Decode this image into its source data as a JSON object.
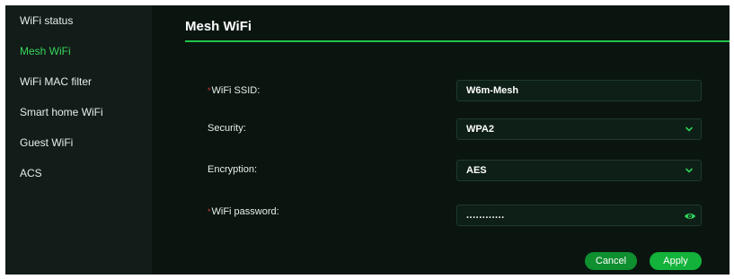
{
  "colors": {
    "accent": "#1fc44a",
    "sidebar_bg": "#121c18",
    "main_bg": "#0a1510",
    "required_mark": "#d9383b"
  },
  "sidebar": {
    "items": [
      {
        "label": "WiFi status",
        "active": false
      },
      {
        "label": "Mesh WiFi",
        "active": true
      },
      {
        "label": "WiFi MAC filter",
        "active": false
      },
      {
        "label": "Smart home WiFi",
        "active": false
      },
      {
        "label": "Guest WiFi",
        "active": false
      },
      {
        "label": "ACS",
        "active": false
      }
    ]
  },
  "page": {
    "title": "Mesh WiFi"
  },
  "form": {
    "ssid": {
      "label": "WiFi SSID:",
      "required_mark": "*",
      "value": "W6m-Mesh"
    },
    "security": {
      "label": "Security:",
      "value": "WPA2",
      "icon": "chevron-down-icon"
    },
    "encryption": {
      "label": "Encryption:",
      "value": "AES",
      "icon": "chevron-down-icon"
    },
    "password": {
      "label": "WiFi password:",
      "required_mark": "*",
      "value": "............",
      "icon": "eye-icon"
    }
  },
  "actions": {
    "cancel_label": "Cancel",
    "apply_label": "Apply"
  }
}
